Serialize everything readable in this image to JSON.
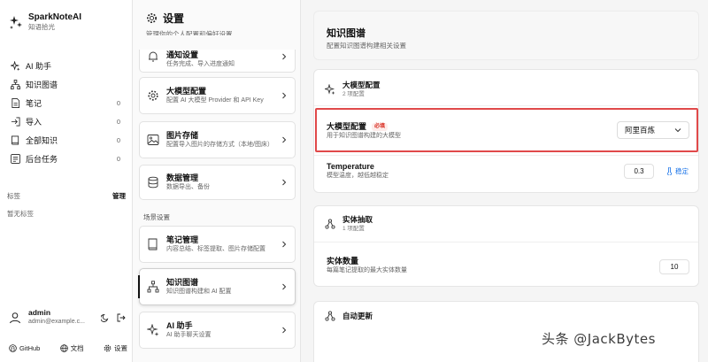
{
  "app": {
    "name": "SparkNoteAI",
    "tagline": "知语拾光"
  },
  "sidebar": {
    "items": [
      {
        "label": "AI 助手",
        "count": ""
      },
      {
        "label": "知识图谱",
        "count": ""
      },
      {
        "label": "笔记",
        "count": "0"
      },
      {
        "label": "导入",
        "count": "0"
      },
      {
        "label": "全部知识",
        "count": "0"
      },
      {
        "label": "后台任务",
        "count": "0"
      }
    ],
    "tags_label": "标签",
    "tags_manage": "管理",
    "no_tags": "暂无标签",
    "user": {
      "name": "admin",
      "email": "admin@example.c..."
    },
    "footer": {
      "github": "GitHub",
      "docs": "文档",
      "settings": "设置"
    }
  },
  "settings": {
    "title": "设置",
    "subtitle": "管理你的个人配置和偏好设置",
    "cards": [
      {
        "title": "通知设置",
        "desc": "任务完成、导入进度通知"
      },
      {
        "title": "大模型配置",
        "desc": "配置 AI 大模型 Provider 和 API Key"
      },
      {
        "title": "图片存储",
        "desc": "配置导入图片的存储方式（本地/图床）"
      },
      {
        "title": "数据管理",
        "desc": "数据导出、备份"
      }
    ],
    "scene_label": "场景设置",
    "scene_cards": [
      {
        "title": "笔记管理",
        "desc": "内容总结、标签提取、图片存储配置"
      },
      {
        "title": "知识图谱",
        "desc": "知识图谱构建和 AI 配置"
      },
      {
        "title": "AI 助手",
        "desc": "AI 助手聊天设置"
      }
    ]
  },
  "kg": {
    "title": "知识图谱",
    "subtitle": "配置知识图谱构建相关设置",
    "llm": {
      "title": "大模型配置",
      "count": "2 项配置",
      "model_label": "大模型配置",
      "required": "必填",
      "model_desc": "用于知识图谱构建的大模型",
      "model_value": "阿里百炼",
      "temp_label": "Temperature",
      "temp_desc": "模型温度，越低越稳定",
      "temp_value": "0.3",
      "temp_badge": "稳定"
    },
    "entity": {
      "title": "实体抽取",
      "count": "1 项配置",
      "max_label": "实体数量",
      "max_desc": "每篇笔记提取的最大实体数量",
      "max_value": "10"
    },
    "auto": {
      "title": "自动更新"
    }
  },
  "watermark": "头条 @JackBytes",
  "colors": {
    "accent_red": "#e0494a",
    "required_red": "#d93025",
    "link_blue": "#1a73e8"
  }
}
